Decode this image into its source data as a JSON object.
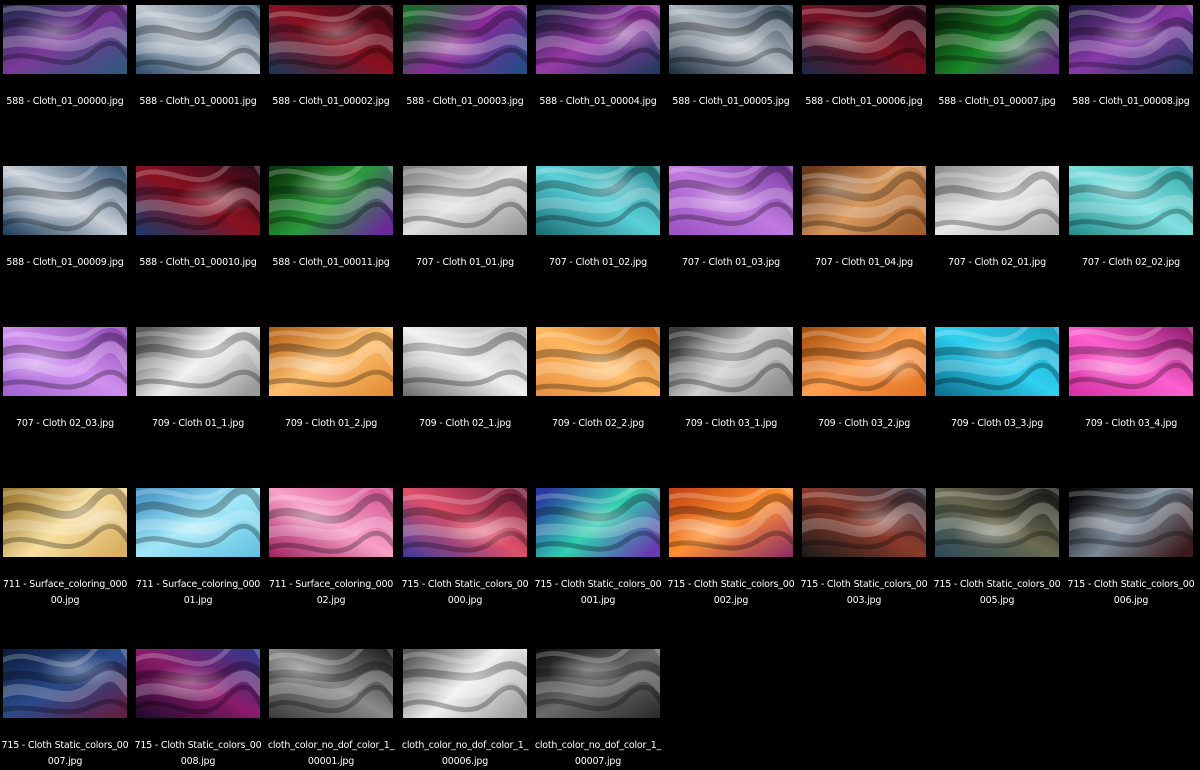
{
  "view": "thumbnail-grid",
  "files": [
    {
      "name": "588 - Cloth_01_00000.jpg",
      "colors": [
        "#1a2a4a",
        "#7a3a9a",
        "#2a5a7a"
      ]
    },
    {
      "name": "588 - Cloth_01_00001.jpg",
      "colors": [
        "#2a4a6a",
        "#c0c8d0",
        "#34506a"
      ]
    },
    {
      "name": "588 - Cloth_01_00002.jpg",
      "colors": [
        "#3a0a14",
        "#8a1020",
        "#1a3a5a"
      ]
    },
    {
      "name": "588 - Cloth_01_00003.jpg",
      "colors": [
        "#1a6a2a",
        "#8a2a9a",
        "#2a4a8a"
      ]
    },
    {
      "name": "588 - Cloth_01_00004.jpg",
      "colors": [
        "#0a1a2a",
        "#9a3aaa",
        "#1a3a5a"
      ]
    },
    {
      "name": "588 - Cloth_01_00005.jpg",
      "colors": [
        "#1a2a3a",
        "#b0b8c0",
        "#2a4050"
      ]
    },
    {
      "name": "588 - Cloth_01_00006.jpg",
      "colors": [
        "#2a0a1a",
        "#7a1020",
        "#1a2a4a"
      ]
    },
    {
      "name": "588 - Cloth_01_00007.jpg",
      "colors": [
        "#0a2a0a",
        "#1a8a2a",
        "#6a2a8a"
      ]
    },
    {
      "name": "588 - Cloth_01_00008.jpg",
      "colors": [
        "#1a1a3a",
        "#8a3aaa",
        "#1a3a5a"
      ]
    },
    {
      "name": "588 - Cloth_01_00009.jpg",
      "colors": [
        "#1a3a5a",
        "#c8d0d8",
        "#2a4a6a"
      ]
    },
    {
      "name": "588 - Cloth_01_00010.jpg",
      "colors": [
        "#2a0a1a",
        "#8a1020",
        "#1a3a6a"
      ]
    },
    {
      "name": "588 - Cloth_01_00011.jpg",
      "colors": [
        "#0a3a0a",
        "#2a9a3a",
        "#6a2a9a"
      ]
    },
    {
      "name": "707 - Cloth 01_01.jpg",
      "colors": [
        "#7a7a7a",
        "#e0e0e0",
        "#909090"
      ]
    },
    {
      "name": "707 - Cloth 01_02.jpg",
      "colors": [
        "#1a6a72",
        "#5ad0d8",
        "#2a8890"
      ]
    },
    {
      "name": "707 - Cloth 01_03.jpg",
      "colors": [
        "#7a3aa0",
        "#c07ae0",
        "#9a50c0"
      ]
    },
    {
      "name": "707 - Cloth 01_04.jpg",
      "colors": [
        "#6a3a1a",
        "#d89a60",
        "#a06030"
      ]
    },
    {
      "name": "707 - Cloth 02_01.jpg",
      "colors": [
        "#8a8a8a",
        "#e8e8e8",
        "#a8a8a8"
      ]
    },
    {
      "name": "707 - Cloth 02_02.jpg",
      "colors": [
        "#208a8a",
        "#80e0e0",
        "#30a8a8"
      ]
    },
    {
      "name": "707 - Cloth 02_03.jpg",
      "colors": [
        "#8a40b0",
        "#d090f0",
        "#a060d0"
      ]
    },
    {
      "name": "709 - Cloth 01_1.jpg",
      "colors": [
        "#5a5a5a",
        "#f0f0f0",
        "#9a9a9a"
      ]
    },
    {
      "name": "709 - Cloth 01_2.jpg",
      "colors": [
        "#b05a10",
        "#ffc070",
        "#e08830"
      ]
    },
    {
      "name": "709 - Cloth 02_1.jpg",
      "colors": [
        "#6a6a6a",
        "#f0f0f0",
        "#b0b0b0"
      ]
    },
    {
      "name": "709 - Cloth 02_2.jpg",
      "colors": [
        "#c06010",
        "#ffb860",
        "#e89040"
      ]
    },
    {
      "name": "709 - Cloth 03_1.jpg",
      "colors": [
        "#3a3a3a",
        "#d0d0d0",
        "#8a8a8a"
      ]
    },
    {
      "name": "709 - Cloth 03_2.jpg",
      "colors": [
        "#a04a08",
        "#ffa050",
        "#e07020"
      ]
    },
    {
      "name": "709 - Cloth 03_3.jpg",
      "colors": [
        "#0a6a8a",
        "#30d0f0",
        "#1aa0c0"
      ]
    },
    {
      "name": "709 - Cloth 03_4.jpg",
      "colors": [
        "#8a1a6a",
        "#ff60d0",
        "#d030a0"
      ]
    },
    {
      "name": "711 - Surface_coloring_00000.jpg",
      "colors": [
        "#a07a30",
        "#f8e0a0",
        "#d8b060"
      ]
    },
    {
      "name": "711 - Surface_coloring_00001.jpg",
      "colors": [
        "#3a8ac0",
        "#a0e8f8",
        "#60c0e0"
      ]
    },
    {
      "name": "711 - Surface_coloring_00002.jpg",
      "colors": [
        "#a02060",
        "#f8a0c8",
        "#d05090"
      ]
    },
    {
      "name": "715 - Cloth Static_colors_00000.jpg",
      "colors": [
        "#6a1a3a",
        "#e0506a",
        "#3a3a9a"
      ]
    },
    {
      "name": "715 - Cloth Static_colors_00001.jpg",
      "colors": [
        "#2a3aa0",
        "#30d0b0",
        "#6a3ab0"
      ]
    },
    {
      "name": "715 - Cloth Static_colors_00002.jpg",
      "colors": [
        "#c04010",
        "#ff9030",
        "#8a2a6a"
      ]
    },
    {
      "name": "715 - Cloth Static_colors_00003.jpg",
      "colors": [
        "#1a1a1a",
        "#8a3a2a",
        "#3a3a4a"
      ]
    },
    {
      "name": "715 - Cloth Static_colors_00005.jpg",
      "colors": [
        "#1a1a1a",
        "#6a6a50",
        "#2a4a5a"
      ]
    },
    {
      "name": "715 - Cloth Static_colors_00006.jpg",
      "colors": [
        "#0a0a0a",
        "#7a8a98",
        "#3a1a1a"
      ]
    },
    {
      "name": "715 - Cloth Static_colors_00007.jpg",
      "colors": [
        "#0a1a3a",
        "#2a4a8a",
        "#6a1a3a"
      ]
    },
    {
      "name": "715 - Cloth Static_colors_00008.jpg",
      "colors": [
        "#1a0a2a",
        "#8a1a6a",
        "#2a3a8a"
      ]
    },
    {
      "name": "cloth_color_no_dof_color_1_00001.jpg",
      "colors": [
        "#1a1a1a",
        "#8a8a8a",
        "#3a3a3a"
      ]
    },
    {
      "name": "cloth_color_no_dof_color_1_00006.jpg",
      "colors": [
        "#5a5a5a",
        "#f0f0f0",
        "#a0a0a0"
      ]
    },
    {
      "name": "cloth_color_no_dof_color_1_00007.jpg",
      "colors": [
        "#0a0a0a",
        "#6a6a6a",
        "#2a2a2a"
      ]
    }
  ]
}
